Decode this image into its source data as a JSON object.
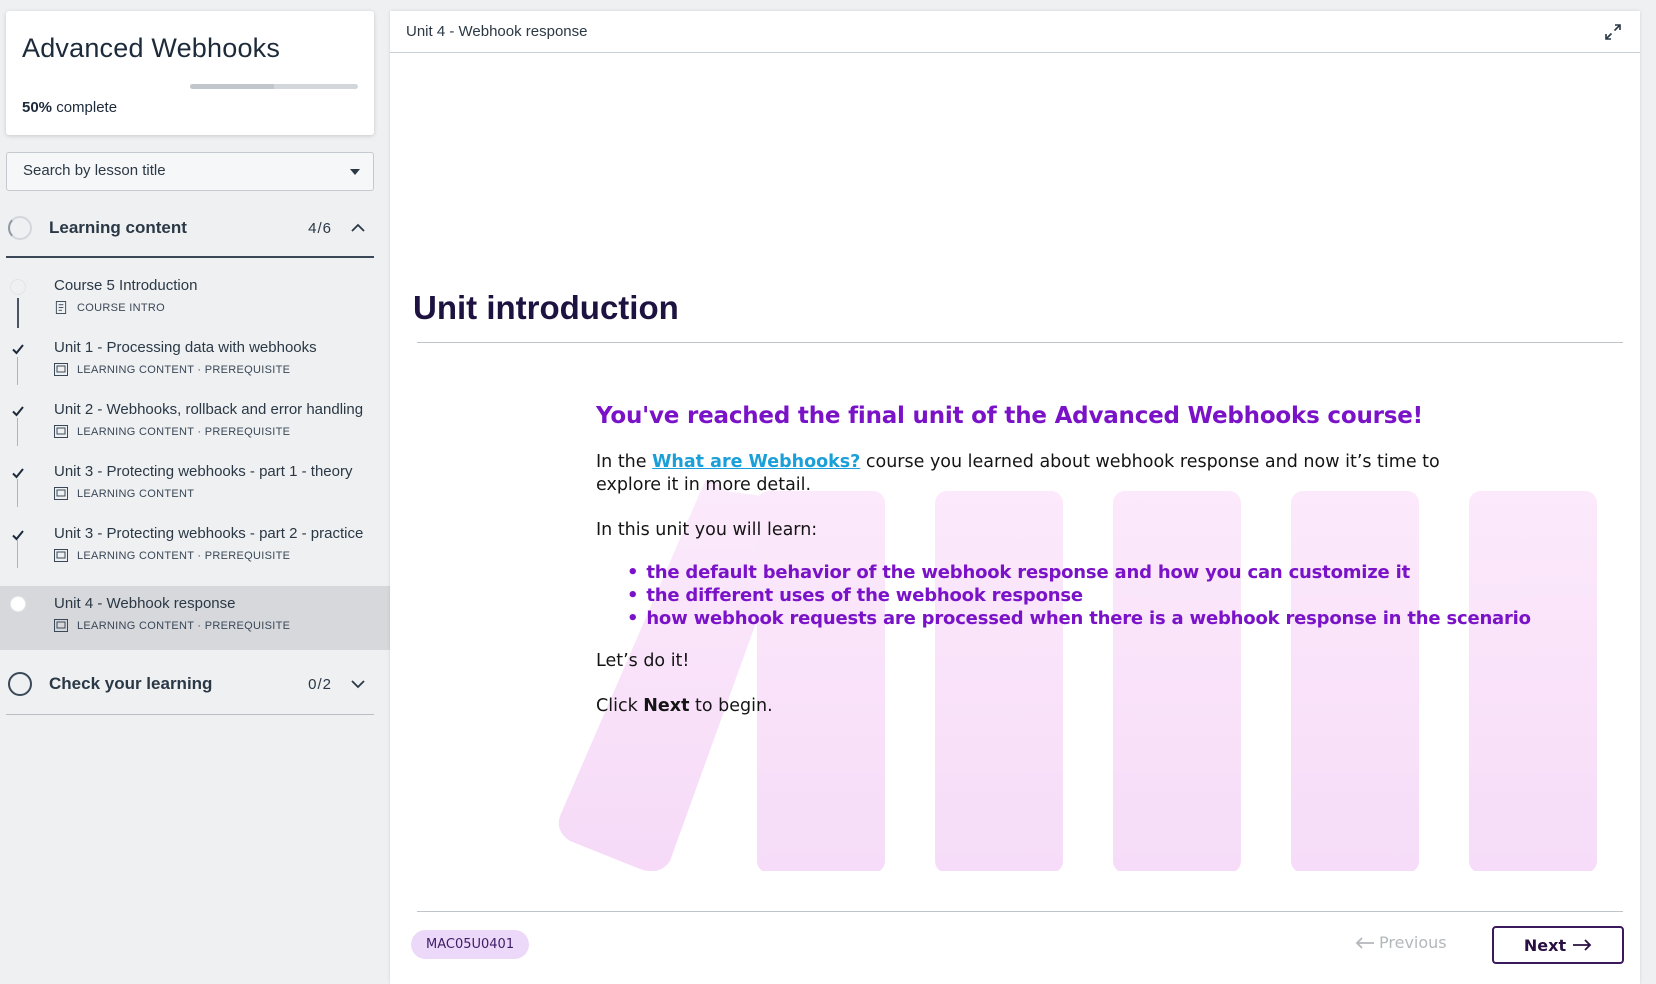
{
  "course": {
    "title": "Advanced Webhooks",
    "progress_percent": "50%",
    "progress_suffix": " complete",
    "progress_fraction": 0.5
  },
  "search": {
    "placeholder": "Search by lesson title"
  },
  "sections": [
    {
      "title": "Learning content",
      "count": "4/6",
      "expanded": true
    },
    {
      "title": "Check your learning",
      "count": "0/2",
      "expanded": false
    }
  ],
  "lessons": [
    {
      "title": "Course 5 Introduction",
      "meta": "COURSE INTRO",
      "status": "not-started",
      "icon": "document-icon"
    },
    {
      "title": "Unit 1 - Processing data with webhooks",
      "meta": "LEARNING CONTENT · PREREQUISITE",
      "status": "completed",
      "icon": "slides-icon"
    },
    {
      "title": "Unit 2 - Webhooks, rollback and error handling",
      "meta": "LEARNING CONTENT · PREREQUISITE",
      "status": "completed",
      "icon": "slides-icon"
    },
    {
      "title": "Unit 3 - Protecting webhooks - part 1 - theory",
      "meta": "LEARNING CONTENT",
      "status": "completed",
      "icon": "slides-icon"
    },
    {
      "title": "Unit 3 - Protecting webhooks - part 2 - practice",
      "meta": "LEARNING CONTENT · PREREQUISITE",
      "status": "completed",
      "icon": "slides-icon"
    },
    {
      "title": "Unit 4 - Webhook response",
      "meta": "LEARNING CONTENT · PREREQUISITE",
      "status": "current",
      "icon": "slides-icon"
    }
  ],
  "main": {
    "unit_title": "Unit 4 - Webhook response",
    "heading": "Unit introduction",
    "headline": "You've reached the final unit of the Advanced Webhooks course!",
    "intro_before_link": "In the ",
    "intro_link": "What are Webhooks?",
    "intro_after_link": " course you learned about webhook response and now it’s time to explore it in more detail.",
    "learn_intro": "In this unit you will learn:",
    "bullets": [
      "the default behavior of the webhook response and how you can customize it",
      "the different uses of the webhook response",
      "how webhook requests are processed when there is a webhook response in the scenario"
    ],
    "lets_do_it": "Let’s do it!",
    "click_prefix": "Click ",
    "click_bold": "Next",
    "click_suffix": " to begin."
  },
  "footer": {
    "lesson_code": "MAC05U0401",
    "previous_label": "Previous",
    "next_label": "Next"
  },
  "colors": {
    "accent_purple": "#7a12c8",
    "link_blue": "#1a9fd8",
    "heading_dark": "#1e1340",
    "badge_bg": "#ecd9f9"
  }
}
